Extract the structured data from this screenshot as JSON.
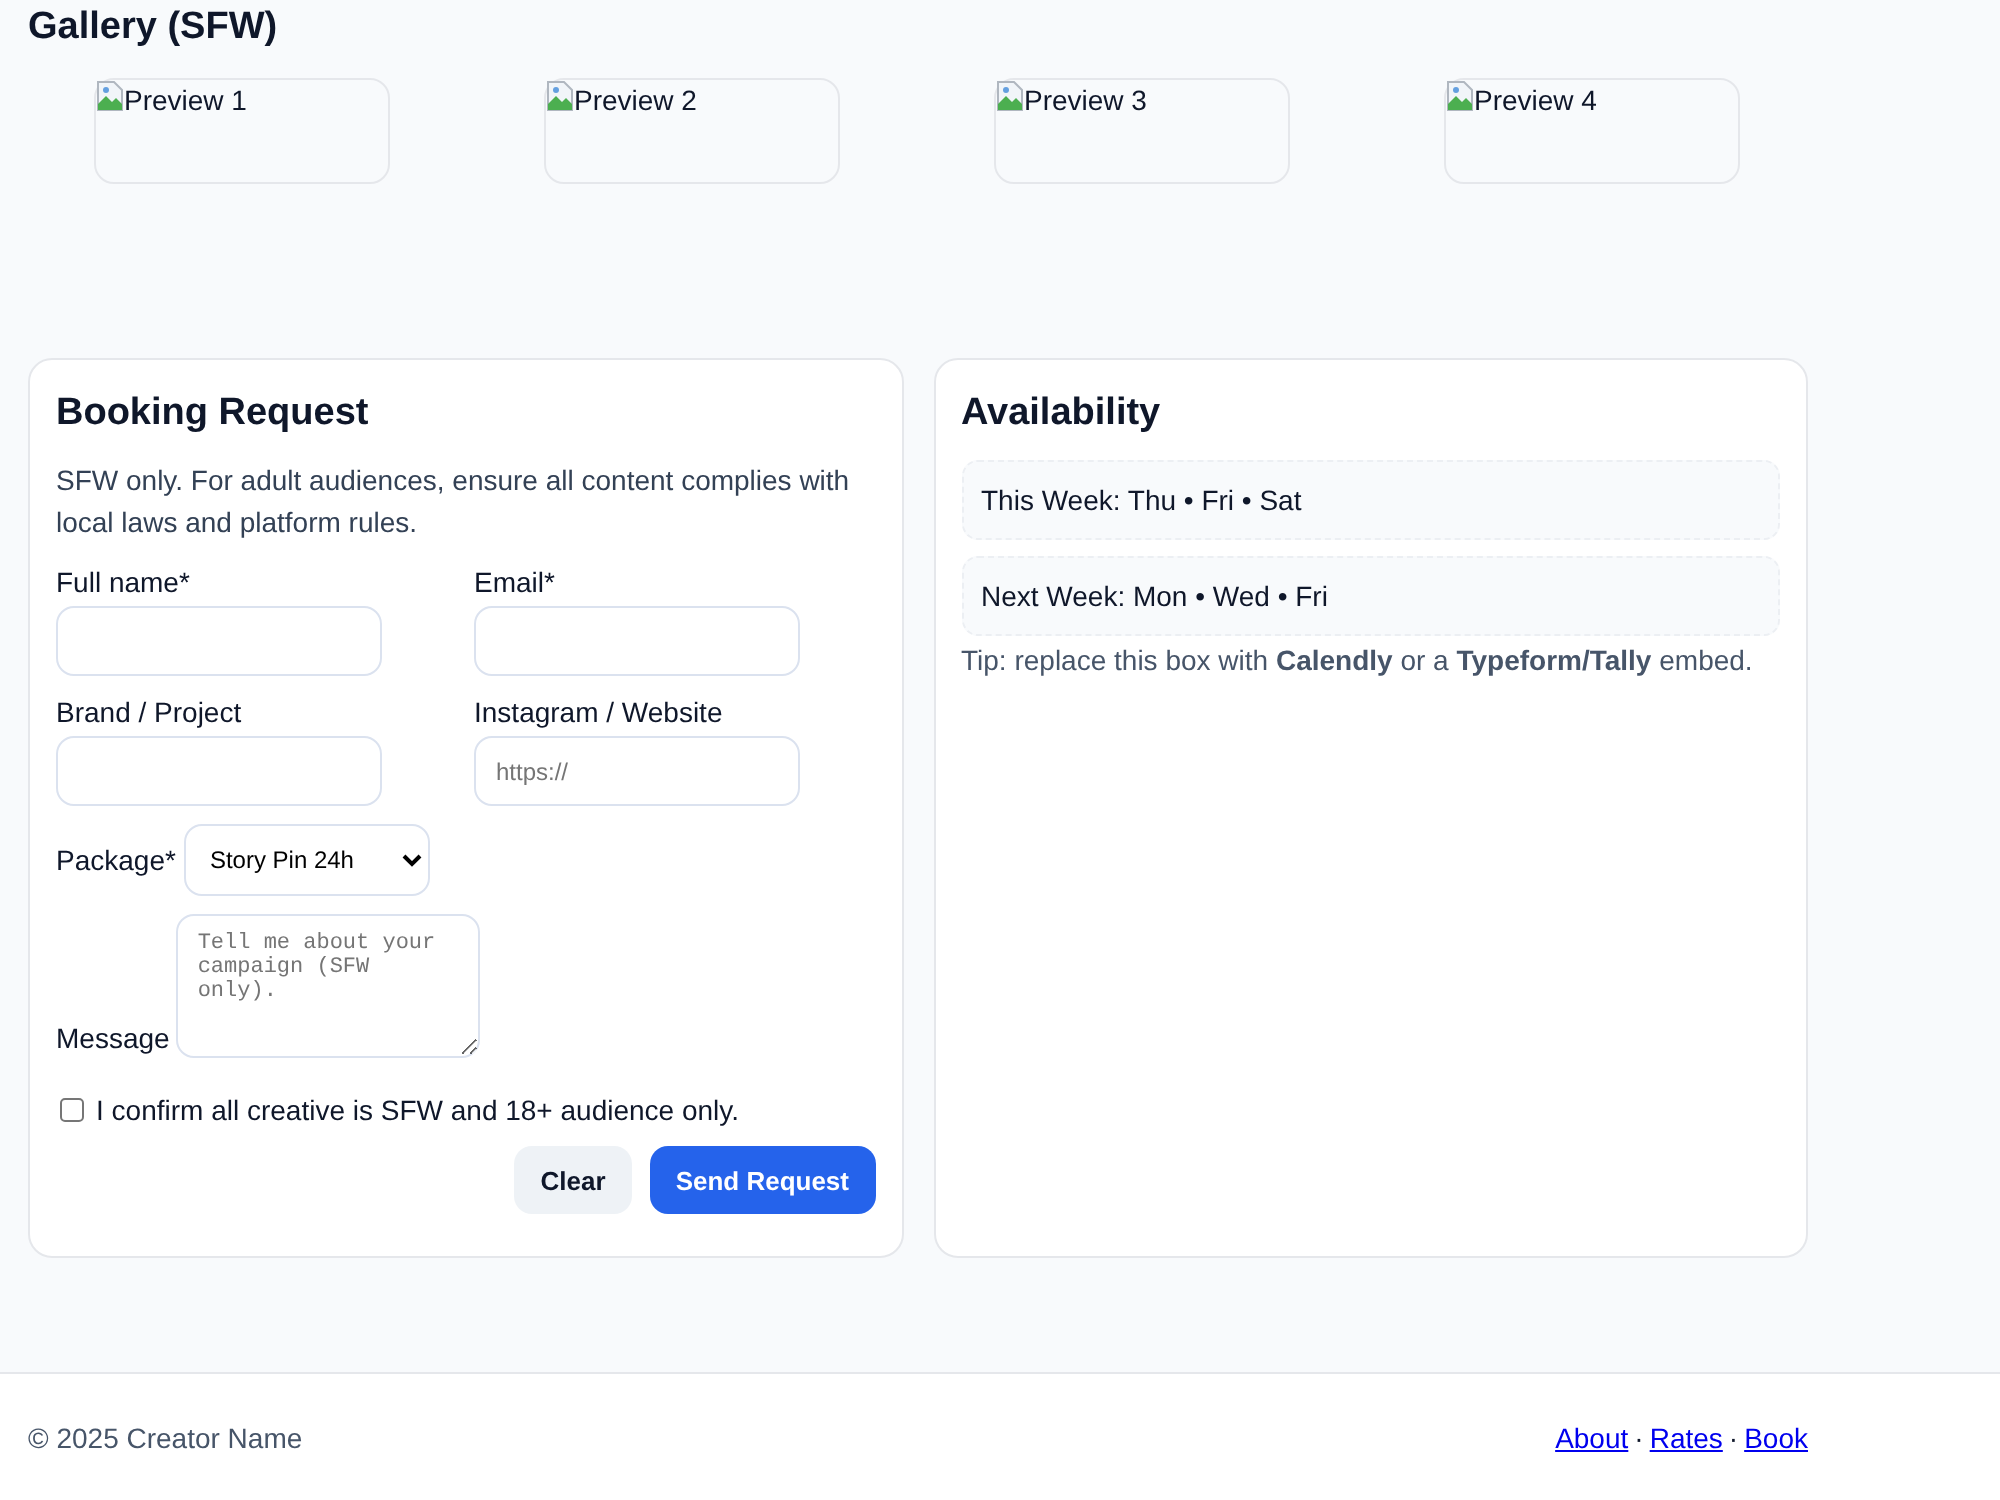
{
  "gallery": {
    "title": "Gallery (SFW)",
    "items": [
      {
        "alt": "Preview 1"
      },
      {
        "alt": "Preview 2"
      },
      {
        "alt": "Preview 3"
      },
      {
        "alt": "Preview 4"
      }
    ]
  },
  "booking": {
    "title": "Booking Request",
    "note": "SFW only. For adult audiences, ensure all content complies with local laws and platform rules.",
    "fields": [
      {
        "label": "Full name*",
        "kind": "text"
      },
      {
        "label": "Email*",
        "kind": "text"
      },
      {
        "label": "Brand / Project",
        "kind": "text"
      },
      {
        "label": "Instagram / Website",
        "kind": "text",
        "placeholder": "https://"
      }
    ],
    "package": {
      "label": "Package*",
      "value": "Story Pin 24h"
    },
    "message": {
      "label": "Message",
      "placeholder": "Tell me about your campaign (SFW only)."
    },
    "confirm": {
      "label": "I confirm all creative is SFW and 18+ audience only.",
      "checked": false
    },
    "buttons": [
      {
        "label": "Clear",
        "kind": "secondary"
      },
      {
        "label": "Send Request",
        "kind": "primary"
      }
    ]
  },
  "availability": {
    "title": "Availability",
    "slots": [
      "This Week: Thu • Fri • Sat",
      "Next Week: Mon • Wed • Fri"
    ],
    "tip": "Tip: replace this box with **Calendly** or a **Typeform/Tally** embed."
  },
  "footer": {
    "copyright": "© 2025 Creator Name",
    "links": [
      "About",
      "Rates",
      "Book"
    ],
    "separator": "·"
  }
}
